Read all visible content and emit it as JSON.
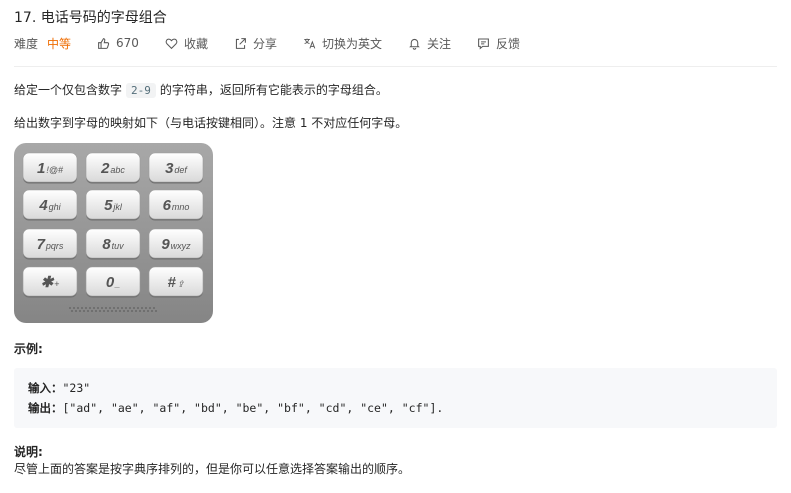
{
  "problem": {
    "title": "17. 电话号码的字母组合",
    "difficulty_label": "难度",
    "difficulty_value": "中等",
    "likes": "670",
    "favorite": "收藏",
    "share": "分享",
    "switch_lang": "切换为英文",
    "follow": "关注",
    "feedback": "反馈"
  },
  "description": {
    "p1_before": "给定一个仅包含数字",
    "p1_code": "2-9",
    "p1_after": "的字符串，返回所有它能表示的字母组合。",
    "p2": "给出数字到字母的映射如下（与电话按键相同）。注意 1 不对应任何字母。"
  },
  "keypad": [
    {
      "digit": "1",
      "letters": "!@#"
    },
    {
      "digit": "2",
      "letters": "abc"
    },
    {
      "digit": "3",
      "letters": "def"
    },
    {
      "digit": "4",
      "letters": "ghi"
    },
    {
      "digit": "5",
      "letters": "jkl"
    },
    {
      "digit": "6",
      "letters": "mno"
    },
    {
      "digit": "7",
      "letters": "pqrs"
    },
    {
      "digit": "8",
      "letters": "tuv"
    },
    {
      "digit": "9",
      "letters": "wxyz"
    },
    {
      "digit": "✱",
      "letters": "+"
    },
    {
      "digit": "0",
      "letters": "_"
    },
    {
      "digit": "#",
      "letters": "⇪"
    }
  ],
  "example": {
    "title": "示例:",
    "input_label": "输入：",
    "input_value": "\"23\"",
    "output_label": "输出：",
    "output_value": "[\"ad\", \"ae\", \"af\", \"bd\", \"be\", \"bf\", \"cd\", \"ce\", \"cf\"]."
  },
  "note": {
    "title": "说明:",
    "text": "尽管上面的答案是按字典序排列的，但是你可以任意选择答案输出的顺序。"
  },
  "colors": {
    "difficulty": "#ef6c00",
    "code_bg": "#f7f8fa",
    "keypad_bg": "#8e8e8e"
  }
}
